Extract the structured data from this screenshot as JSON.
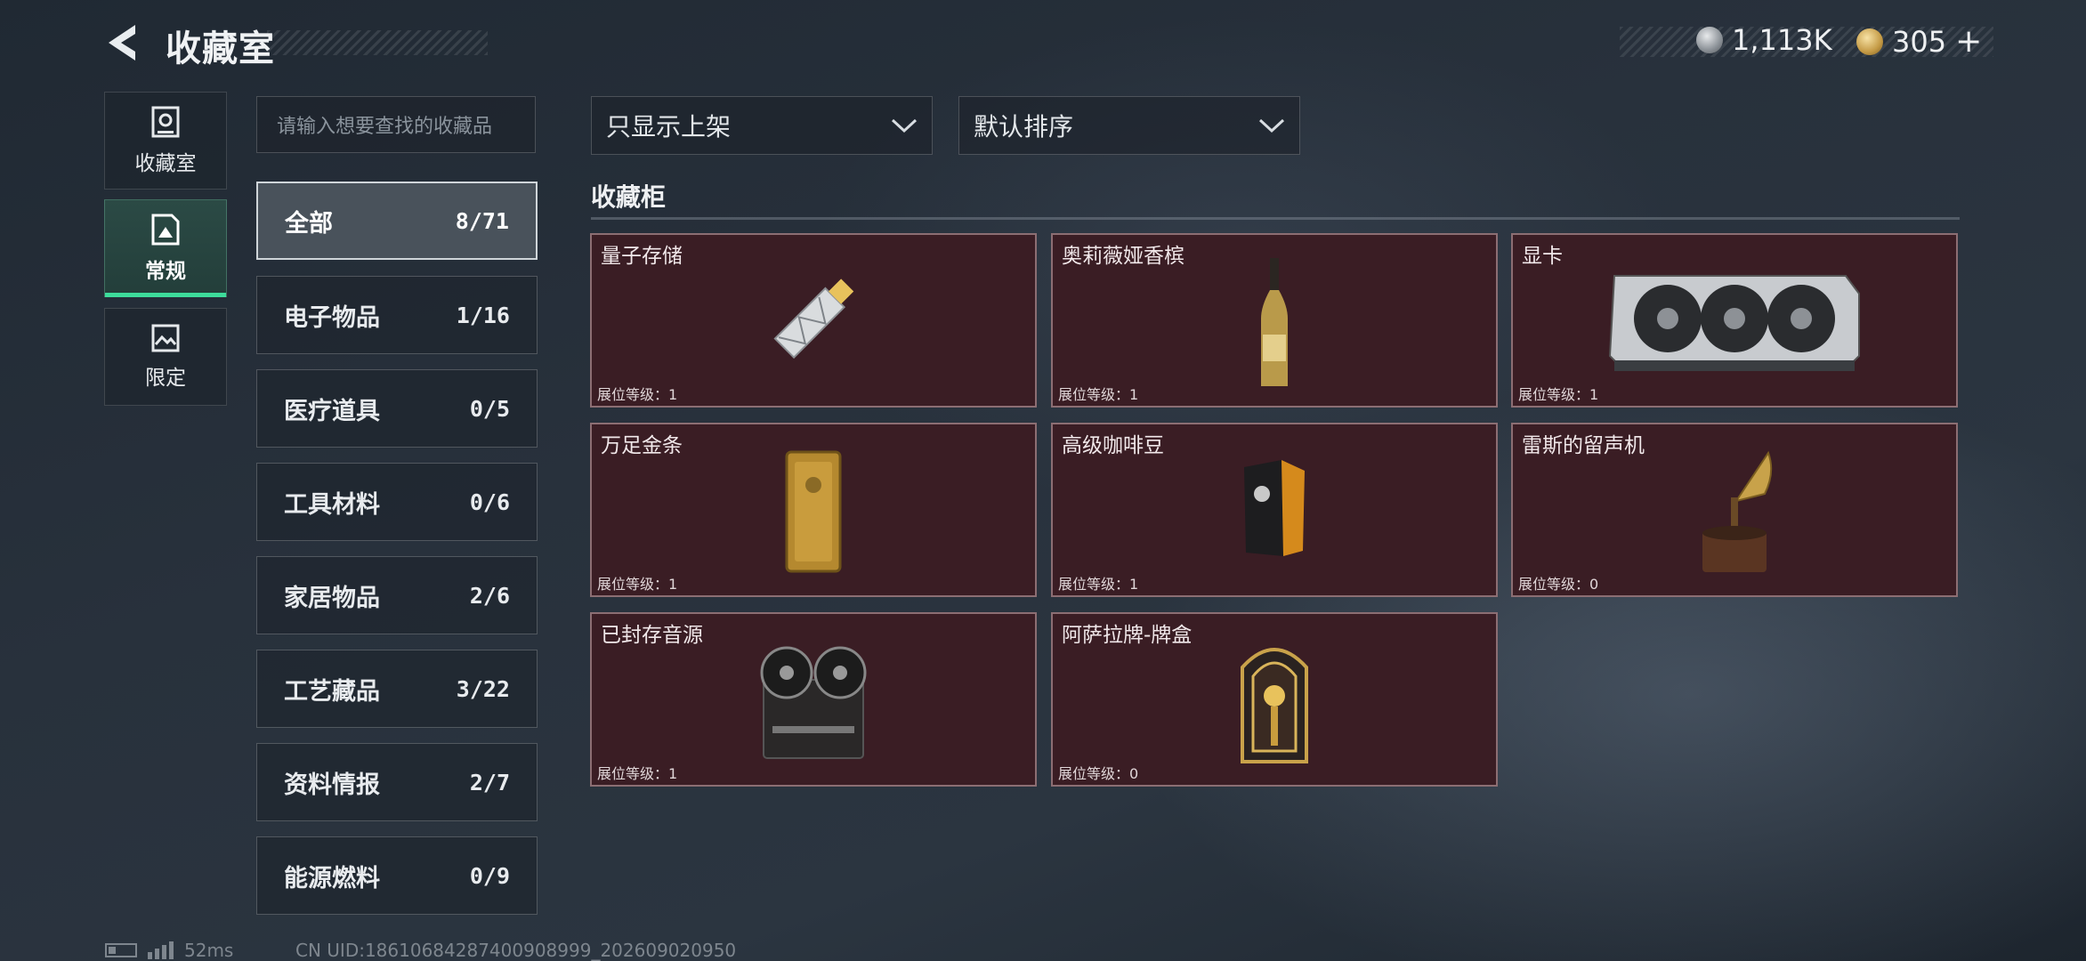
{
  "header": {
    "title": "收藏室"
  },
  "currency": {
    "silver": "1,113K",
    "gold": "305",
    "plus": "+"
  },
  "modes": [
    {
      "label": "收藏室",
      "icon": "vault-icon"
    },
    {
      "label": "常规",
      "icon": "image-frame-icon"
    },
    {
      "label": "限定",
      "icon": "landscape-icon"
    }
  ],
  "search": {
    "placeholder": "请输入想要查找的收藏品"
  },
  "categories": [
    {
      "name": "全部",
      "count": "8/71"
    },
    {
      "name": "电子物品",
      "count": "1/16"
    },
    {
      "name": "医疗道具",
      "count": "0/5"
    },
    {
      "name": "工具材料",
      "count": "0/6"
    },
    {
      "name": "家居物品",
      "count": "2/6"
    },
    {
      "name": "工艺藏品",
      "count": "3/22"
    },
    {
      "name": "资料情报",
      "count": "2/7"
    },
    {
      "name": "能源燃料",
      "count": "0/9"
    }
  ],
  "filters": {
    "display": "只显示上架",
    "sort": "默认排序"
  },
  "section": {
    "title": "收藏柜"
  },
  "items": [
    {
      "name": "量子存储",
      "level": "展位等级：1"
    },
    {
      "name": "奥莉薇娅香槟",
      "level": "展位等级：1"
    },
    {
      "name": "显卡",
      "level": "展位等级：1"
    },
    {
      "name": "万足金条",
      "level": "展位等级：1"
    },
    {
      "name": "高级咖啡豆",
      "level": "展位等级：1"
    },
    {
      "name": "雷斯的留声机",
      "level": "展位等级：0"
    },
    {
      "name": "已封存音源",
      "level": "展位等级：1"
    },
    {
      "name": "阿萨拉牌-牌盒",
      "level": "展位等级：0"
    }
  ],
  "status": {
    "ping": "52ms",
    "uid": "CN UID:18610684287400908999_202609020950"
  }
}
